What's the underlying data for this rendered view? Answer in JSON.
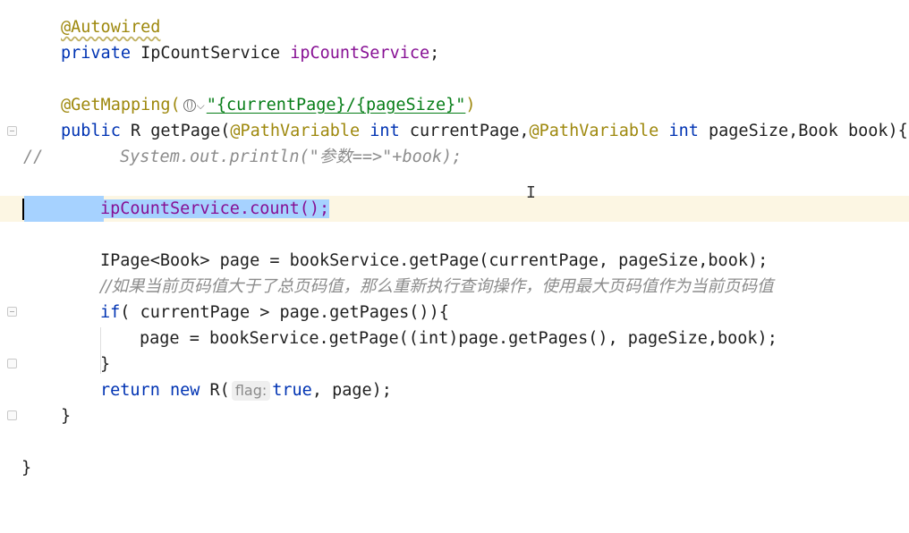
{
  "editor": {
    "line_2_field_type": "IpCountService",
    "line_2_field_name": "ipCountService",
    "line_4_mapping_path": "\"{currentPage}/{pageSize}\"",
    "line_5_method_name": "getPage",
    "line_6_comment_prefix": "//",
    "line_6_comment_body": "System.out.println(\"参数==>\"+book);",
    "line_8_call": "ipCountService.count();",
    "line_10_statement": "IPage<Book> page = bookService.getPage(currentPage, pageSize,book);",
    "line_11_comment": "//如果当前页码值大于了总页码值，那么重新执行查询操作，使用最大页码值作为当前页码值",
    "line_12_condition": "currentPage > page.getPages()",
    "line_13_statement": "page = bookService.getPage((int)page.getPages(), pageSize,book);",
    "line_15_param_hint": "flag:",
    "line_15_arg": "true"
  },
  "colors": {
    "keyword": "#0033b3",
    "annotation": "#9e880d",
    "field": "#871094",
    "string": "#067d17",
    "comment": "#8c8c8c",
    "selection": "#a6d2ff",
    "current_line": "#fcf6e3"
  }
}
